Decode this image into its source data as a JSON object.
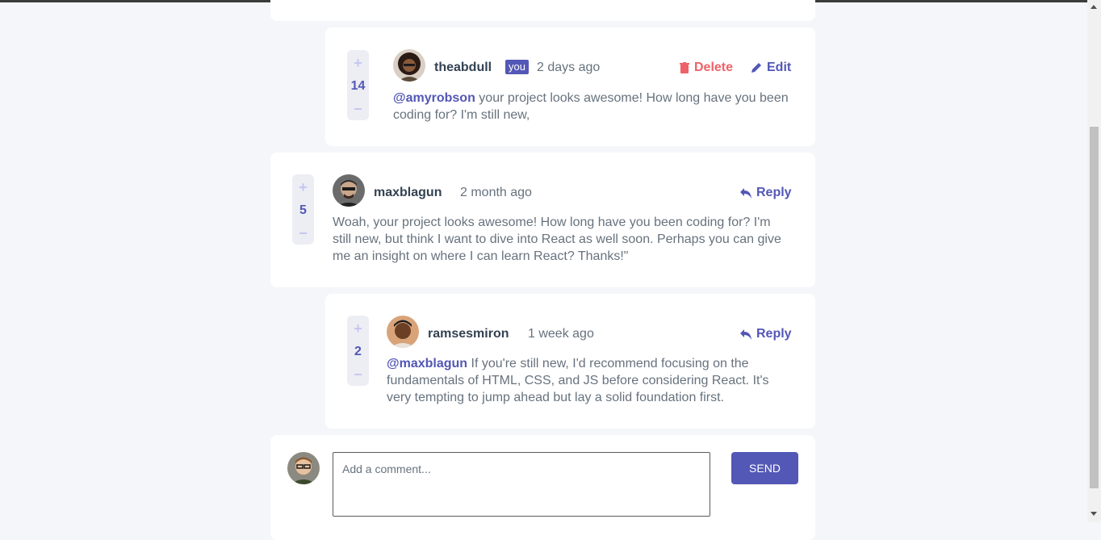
{
  "colors": {
    "accent": "#5357b6",
    "delete": "#ed6368",
    "background": "#f5f6fa",
    "card": "#ffffff"
  },
  "comments": [
    {
      "score": "14",
      "username": "theabdull",
      "you_badge": "you",
      "time": "2 days ago",
      "delete_label": "Delete",
      "edit_label": "Edit",
      "mention": "@amyrobson",
      "text": " your project looks awesome! How long have you been coding for? I'm still new,"
    },
    {
      "score": "5",
      "username": "maxblagun",
      "time": "2 month ago",
      "reply_label": "Reply",
      "text": "Woah, your project looks awesome! How long have you been coding for? I'm still new, but think I want to dive into React as well soon. Perhaps you can give me an insight on where I can learn React? Thanks!\""
    },
    {
      "score": "2",
      "username": "ramsesmiron",
      "time": "1 week ago",
      "reply_label": "Reply",
      "mention": "@maxblagun",
      "text": " If you're still new, I'd recommend focusing on the fundamentals of HTML, CSS, and JS before considering React. It's very tempting to jump ahead but lay a solid foundation first."
    }
  ],
  "vote": {
    "plus": "+",
    "minus": "−"
  },
  "composer": {
    "placeholder": "Add a comment...",
    "send_label": "SEND"
  }
}
